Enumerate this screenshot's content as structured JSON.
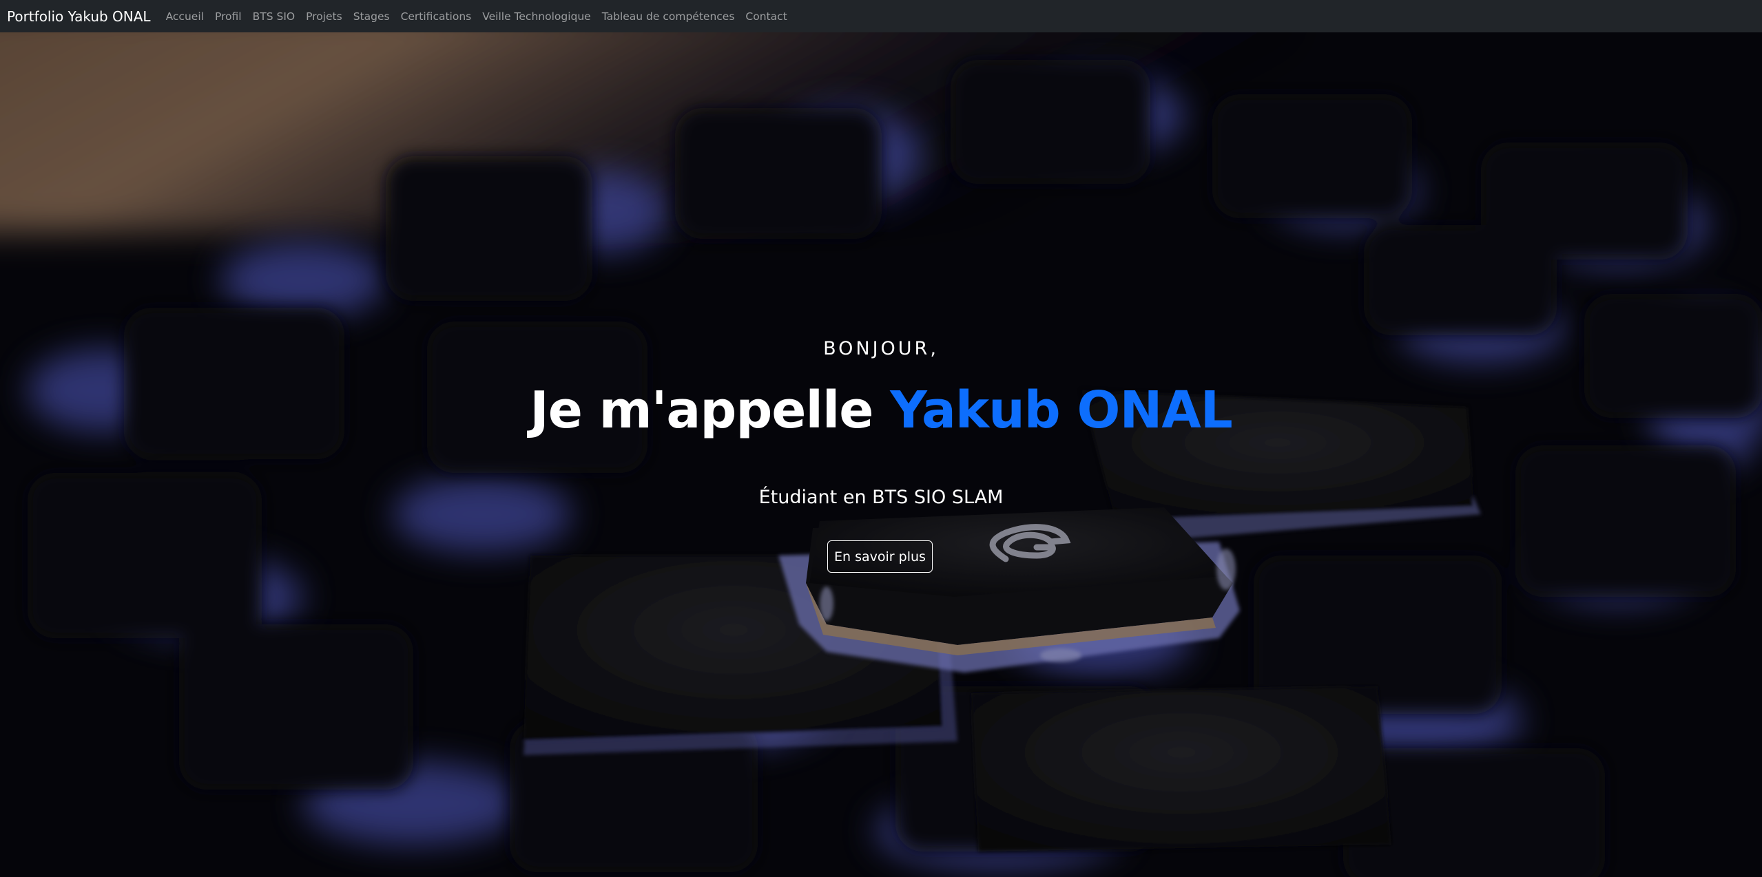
{
  "navbar": {
    "brand": "Portfolio Yakub ONAL",
    "links": [
      "Accueil",
      "Profil",
      "BTS SIO",
      "Projets",
      "Stages",
      "Certifications",
      "Veille Technologique",
      "Tableau de compétences",
      "Contact"
    ]
  },
  "hero": {
    "greeting": "BONJOUR,",
    "headline_prefix": "Je m'appelle ",
    "headline_name": "Yakub ONAL",
    "subtitle": "Étudiant en BTS SIO SLAM",
    "cta_label": "En savoir plus",
    "background_image": "keyboard-backlit-image"
  },
  "colors": {
    "navbar_bg": "#212529",
    "accent": "#0d6efd",
    "nav_link": "rgba(255,255,255,0.55)"
  }
}
